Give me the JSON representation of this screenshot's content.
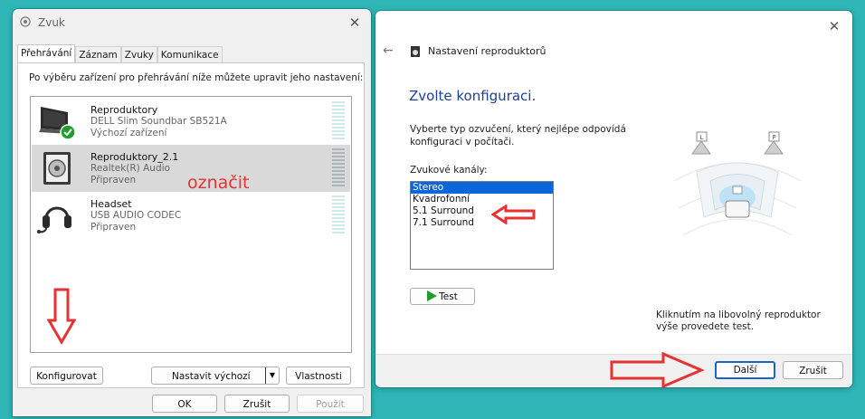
{
  "sound_dialog": {
    "title": "Zvuk",
    "close_glyph": "✕",
    "tabs": [
      {
        "label": "Přehrávání",
        "active": true
      },
      {
        "label": "Záznam",
        "active": false
      },
      {
        "label": "Zvuky",
        "active": false
      },
      {
        "label": "Komunikace",
        "active": false
      }
    ],
    "instruction": "Po výběru zařízení pro přehrávání níže můžete upravit jeho nastavení:",
    "devices": [
      {
        "name": "Reproduktory",
        "description": "DELL Slim Soundbar SB521A",
        "status": "Výchozí zařízení",
        "icon": "monitor-icon",
        "default": true,
        "selected": false
      },
      {
        "name": "Reproduktory_2.1",
        "description": "Realtek(R) Audio",
        "status": "Připraven",
        "icon": "speaker-icon",
        "default": false,
        "selected": true
      },
      {
        "name": "Headset",
        "description": "USB AUDIO  CODEC",
        "status": "Připraven",
        "icon": "headset-icon",
        "default": false,
        "selected": false
      }
    ],
    "buttons": {
      "configure": "Konfigurovat",
      "set_default": "Nastavit výchozí",
      "properties": "Vlastnosti",
      "ok": "OK",
      "cancel": "Zrušit",
      "apply": "Použít"
    }
  },
  "annotations": {
    "mark_label": "označit"
  },
  "setup_dialog": {
    "close_glyph": "✕",
    "back_glyph": "←",
    "title": "Nastavení reproduktorů",
    "heading": "Zvolte konfiguraci.",
    "description": "Vyberte typ ozvučení, který nejlépe odpovídá konfiguraci v počítači.",
    "channels_label": "Zvukové kanály:",
    "channels": [
      {
        "label": "Stereo",
        "selected": true
      },
      {
        "label": "Kvadrofonní",
        "selected": false
      },
      {
        "label": "5.1 Surround",
        "selected": false
      },
      {
        "label": "7.1 Surround",
        "selected": false
      }
    ],
    "test_button": "Test",
    "hint": "Kliknutím na libovolný reproduktor výše provedete test.",
    "speaker_letters": {
      "left": "L",
      "right": "P"
    },
    "buttons": {
      "next": "Další",
      "cancel": "Zrušit"
    }
  },
  "colors": {
    "background": "#2fb7b8",
    "annotation_red": "#e53232",
    "heading_blue": "#1c3f94",
    "selection_blue": "#0a66d9",
    "default_check_green": "#1f9e2c"
  }
}
